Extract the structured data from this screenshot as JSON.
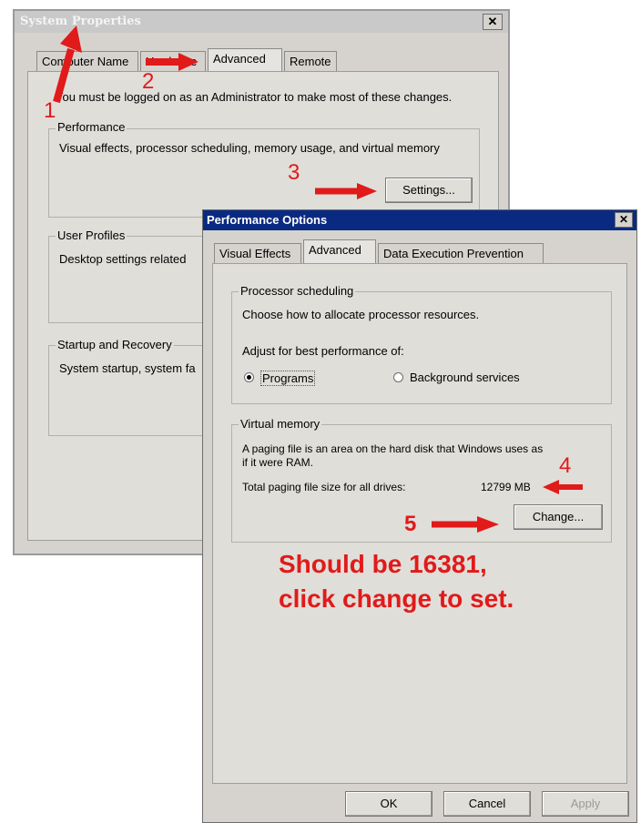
{
  "system_properties": {
    "title": "System Properties",
    "close_glyph": "✕",
    "tabs": [
      "Computer Name",
      "Hardware",
      "Advanced",
      "Remote"
    ],
    "admin_note": "You must be logged on as an Administrator to make most of these changes.",
    "performance": {
      "label": "Performance",
      "description": "Visual effects, processor scheduling, memory usage, and virtual memory",
      "settings_button": "Settings..."
    },
    "user_profiles": {
      "label": "User Profiles",
      "description": "Desktop settings related"
    },
    "startup_recovery": {
      "label": "Startup and Recovery",
      "description": "System startup, system fa"
    }
  },
  "performance_options": {
    "title": "Performance Options",
    "close_glyph": "✕",
    "tabs": [
      "Visual Effects",
      "Advanced",
      "Data Execution Prevention"
    ],
    "processor_scheduling": {
      "label": "Processor scheduling",
      "description": "Choose how to allocate processor resources.",
      "adjust_label": "Adjust for best performance of:",
      "programs_option": "Programs",
      "background_option": "Background services",
      "selected": "Programs"
    },
    "virtual_memory": {
      "label": "Virtual memory",
      "description_line1": "A paging file is an area on the hard disk that Windows uses as",
      "description_line2": "if it were RAM.",
      "total_label": "Total paging file size for all drives:",
      "total_value": "12799 MB",
      "change_button": "Change..."
    },
    "ok_button": "OK",
    "cancel_button": "Cancel",
    "apply_button": "Apply"
  },
  "annotations": {
    "step1": "1",
    "step2": "2",
    "step3": "3",
    "step4": "4",
    "step5": "5",
    "note_line1": "Should be 16381,",
    "note_line2": "click change to set.",
    "color": "#e11a1a"
  }
}
